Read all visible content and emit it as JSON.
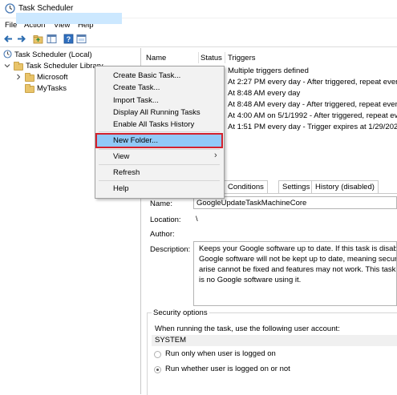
{
  "window": {
    "title": "Task Scheduler"
  },
  "menu": [
    "File",
    "Action",
    "View",
    "Help"
  ],
  "tree": {
    "root": "Task Scheduler (Local)",
    "library": "Task Scheduler Library",
    "folders": [
      "Microsoft",
      "MyTasks"
    ]
  },
  "columns": {
    "name": "Name",
    "status": "Status",
    "triggers": "Triggers"
  },
  "task_rows": [
    "Multiple triggers defined",
    "At 2:27 PM every day - After triggered, repeat every",
    "At 8:48 AM every day",
    "At 8:48 AM every day - After triggered, repeat every",
    "At 4:00 AM on 5/1/1992 - After triggered, repeat every",
    "At 1:51 PM every day - Trigger expires at 1/29/2029"
  ],
  "context_menu": {
    "items_top": [
      "Create Basic Task...",
      "Create Task...",
      "Import Task...",
      "Display All Running Tasks",
      "Enable All Tasks History"
    ],
    "new_folder": "New Folder...",
    "view": "View",
    "refresh": "Refresh",
    "help": "Help",
    "submenu_arrow": "›"
  },
  "tabs": [
    "Conditions",
    "Settings",
    "History (disabled)"
  ],
  "details": {
    "name_label": "Name:",
    "name_value": "GoogleUpdateTaskMachineCore",
    "location_label": "Location:",
    "location_value": "\\",
    "author_label": "Author:",
    "author_value": "",
    "description_label": "Description:",
    "description_lines": [
      "Keeps your Google software up to date. If this task is disable",
      "Google software will not be kept up to date, meaning security",
      "arise cannot be fixed and features may not work. This task un",
      "is no Google software using it."
    ]
  },
  "security": {
    "title": "Security options",
    "prompt": "When running the task, use the following user account:",
    "account": "SYSTEM",
    "options": [
      "Run only when user is logged on",
      "Run whether user is logged on or not"
    ],
    "selected_option": 1
  },
  "icons": {
    "app": "task-scheduler-icon",
    "toolbar": [
      "back-arrow-icon",
      "forward-arrow-icon",
      "folder-up-icon",
      "show-hide-tree-icon",
      "help-icon",
      "console-icon"
    ]
  },
  "colors": {
    "highlight_border": "#d3212d",
    "menu_highlight": "#91c9f7",
    "tree_selection": "#cce8ff"
  }
}
